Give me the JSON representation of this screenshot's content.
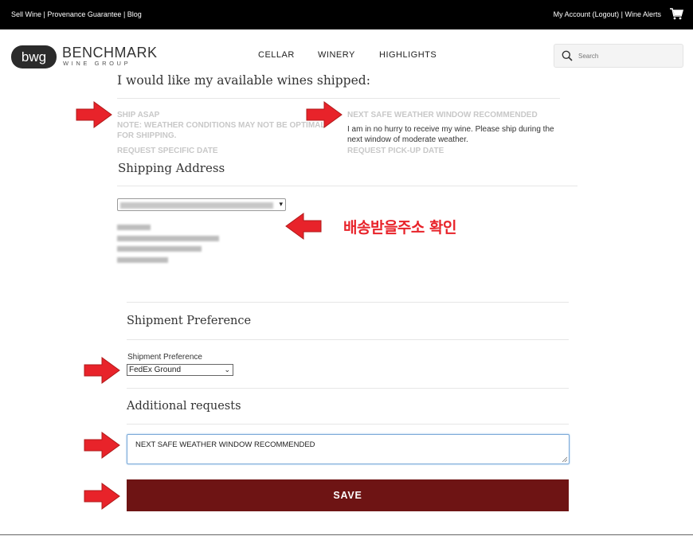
{
  "topbar": {
    "sell_wine": "Sell Wine",
    "provenance": "Provenance Guarantee",
    "blog": "Blog",
    "sep": " | ",
    "my_account": "My Account (Logout)",
    "wine_alerts": "Wine Alerts",
    "cart_icon": "cart-icon"
  },
  "header": {
    "logo_mark": "bwg",
    "logo_name": "BENCHMARK",
    "logo_sub": "WINE GROUP",
    "nav": [
      "CELLAR",
      "WINERY",
      "HIGHLIGHTS"
    ],
    "search_placeholder": "Search",
    "search_icon": "search-icon"
  },
  "shipping": {
    "heading": "I would like my available wines shipped:",
    "option_ship_asap": "SHIP ASAP",
    "option_note": "NOTE: WEATHER CONDITIONS MAY NOT BE OPTIMAL FOR SHIPPING.",
    "option_specific_date": "REQUEST SPECIFIC DATE",
    "option_weather": "NEXT SAFE WEATHER WINDOW RECOMMENDED",
    "option_weather_desc": "I am in no hurry to receive my wine. Please ship during the next window of moderate weather.",
    "option_pickup": "REQUEST PICK-UP DATE"
  },
  "address": {
    "heading": "Shipping Address",
    "select_suffix": "E"
  },
  "annotation": {
    "callout": "배송받을주소 확인",
    "arrow_color": "#e8232a"
  },
  "preference": {
    "heading": "Shipment Preference",
    "label": "Shipment Preference",
    "selected": "FedEx Ground"
  },
  "additional": {
    "heading": "Additional requests",
    "value": "NEXT SAFE WEATHER WINDOW RECOMMENDED"
  },
  "save_label": "SAVE",
  "colors": {
    "save_bg": "#6e1414",
    "topbar_bg": "#000000",
    "muted_option": "#c8c8c8"
  }
}
